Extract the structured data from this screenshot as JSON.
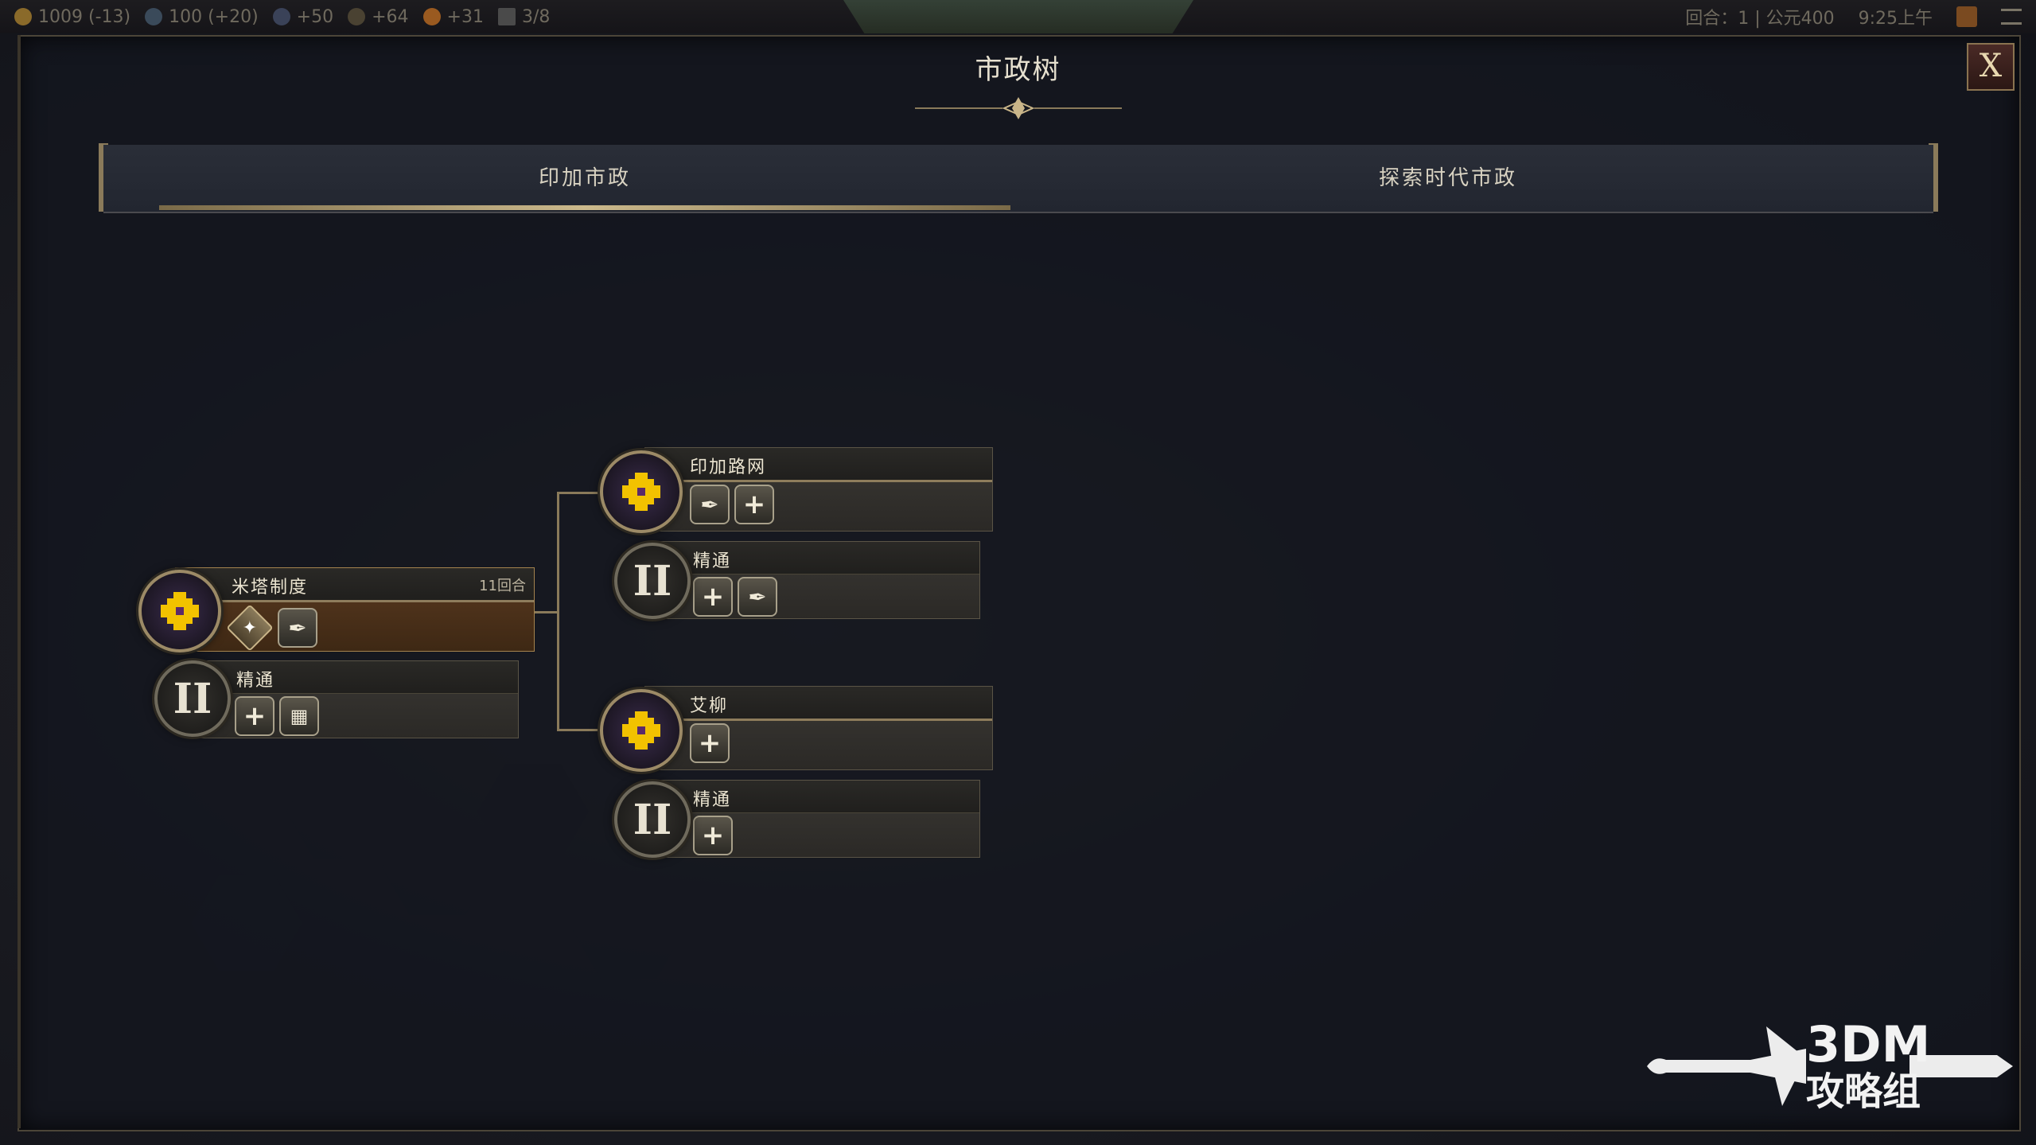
{
  "topbar": {
    "resources": [
      {
        "icon": "gold-icon",
        "text": "1009 (-13)",
        "color": "#c8a03a"
      },
      {
        "icon": "science-icon",
        "text": "100 (+20)",
        "color": "#6b8fb0"
      },
      {
        "icon": "culture-icon",
        "text": "+50",
        "color": "#8aa0c8"
      },
      {
        "icon": "happiness-icon",
        "text": "+64",
        "color": "#a08a5a"
      },
      {
        "icon": "influence-icon",
        "text": "+31",
        "color": "#d08030"
      },
      {
        "icon": "settlements-icon",
        "text": "3/8",
        "color": "#8a8a8a"
      }
    ],
    "turn_label": "回合：1 | 公元400",
    "time": "9:25上午"
  },
  "panel": {
    "title": "市政树",
    "close_label": "X"
  },
  "tabs": [
    {
      "label": "印加市政",
      "active": true
    },
    {
      "label": "探索时代市政",
      "active": false
    }
  ],
  "tree": {
    "root": {
      "name": "米塔制度",
      "turns": "11回合",
      "icons": [
        "unit-diamond-icon",
        "quill-icon"
      ],
      "mastery": {
        "label": "精通",
        "icons": [
          "plus-icon",
          "map-tile-icon"
        ]
      }
    },
    "branch_top": {
      "name": "印加路网",
      "icons": [
        "quill-icon",
        "plus-icon"
      ],
      "mastery": {
        "label": "精通",
        "icons": [
          "plus-icon",
          "quill-icon"
        ]
      }
    },
    "branch_bottom": {
      "name": "艾柳",
      "icons": [
        "plus-icon"
      ],
      "mastery": {
        "label": "精通",
        "icons": [
          "plus-icon"
        ]
      }
    }
  },
  "watermark": {
    "line1": "3DM",
    "line2": "攻略组"
  }
}
